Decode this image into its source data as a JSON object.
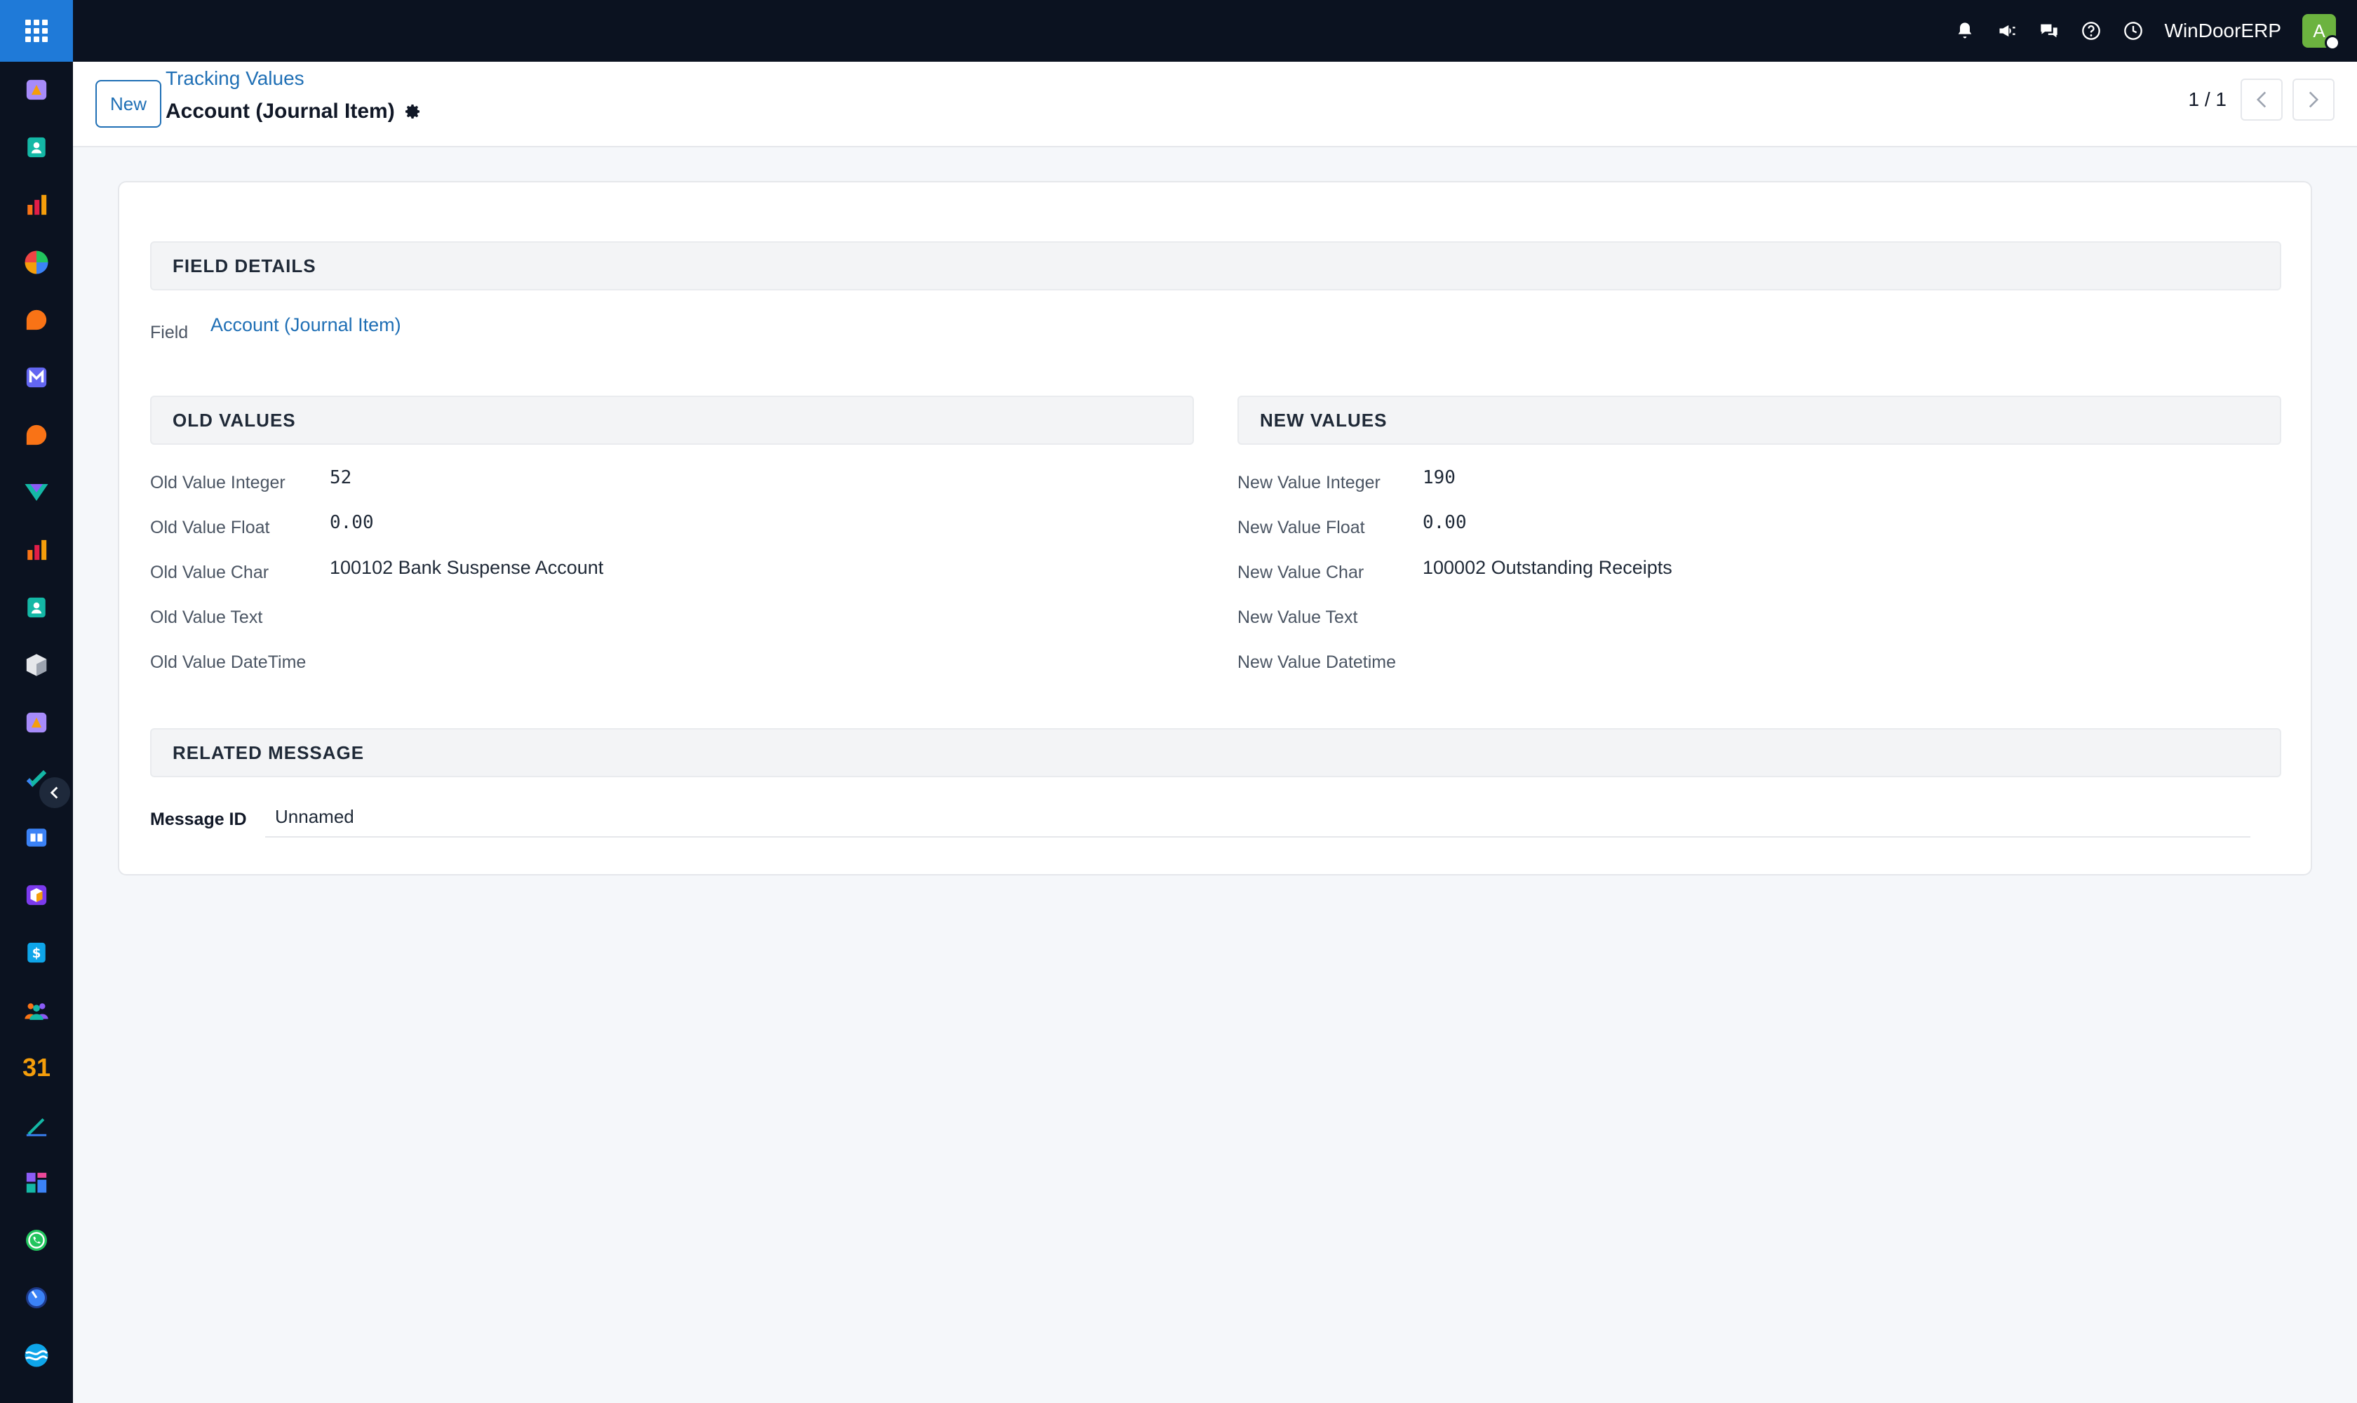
{
  "topbar": {
    "company": "WinDoorERP",
    "avatar_initial": "A",
    "icons": [
      "bell-icon",
      "megaphone-icon",
      "chat-icon",
      "help-icon",
      "clock-icon"
    ]
  },
  "sidebar": {
    "apps": [
      "spreadsheet-icon",
      "contacts-icon",
      "reporting-icon",
      "pie-icon",
      "discuss-icon",
      "mail-icon",
      "live-chat-icon",
      "project-icon",
      "dashboard-icon",
      "employees-icon",
      "inventory-icon",
      "documents-icon",
      "tasks-icon",
      "knowledge-icon",
      "product-icon",
      "invoice-icon",
      "team-icon",
      "calendar-icon",
      "sign-icon",
      "apps-dashboard-icon",
      "whatsapp-icon",
      "timer-icon",
      "website-icon"
    ],
    "calendar_label": "31"
  },
  "control_panel": {
    "new_label": "New",
    "breadcrumb": "Tracking Values",
    "title": "Account (Journal Item)",
    "pager": "1 / 1"
  },
  "form": {
    "field_details": {
      "header": "FIELD DETAILS",
      "field_label": "Field",
      "field_value": "Account (Journal Item)"
    },
    "old_values": {
      "header": "OLD VALUES",
      "rows": [
        {
          "label": "Old Value Integer",
          "value": "52"
        },
        {
          "label": "Old Value Float",
          "value": "0.00"
        },
        {
          "label": "Old Value Char",
          "value": "100102 Bank Suspense Account"
        },
        {
          "label": "Old Value Text",
          "value": ""
        },
        {
          "label": "Old Value DateTime",
          "value": ""
        }
      ]
    },
    "new_values": {
      "header": "NEW VALUES",
      "rows": [
        {
          "label": "New Value Integer",
          "value": "190"
        },
        {
          "label": "New Value Float",
          "value": "0.00"
        },
        {
          "label": "New Value Char",
          "value": "100002 Outstanding Receipts"
        },
        {
          "label": "New Value Text",
          "value": ""
        },
        {
          "label": "New Value Datetime",
          "value": ""
        }
      ]
    },
    "related_message": {
      "header": "RELATED MESSAGE",
      "message_label": "Message ID",
      "message_value": "Unnamed"
    }
  },
  "colors": {
    "topbar_bg": "#0b1220",
    "apps_button": "#1f7ad8",
    "link": "#1f6fb5",
    "avatar": "#6cb33f"
  }
}
